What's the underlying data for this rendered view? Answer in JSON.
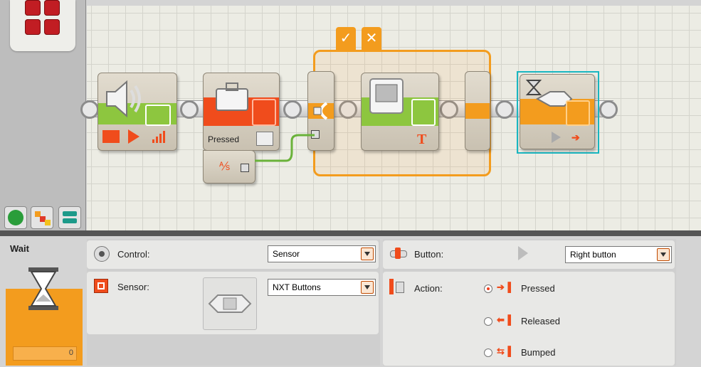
{
  "program": {
    "sound_block": {},
    "nxt_button_block": {
      "label": "Pressed"
    },
    "switch_block": {},
    "wait_block": {}
  },
  "config": {
    "block_title": "Wait",
    "counter_value": "0",
    "control": {
      "label": "Control:",
      "value": "Sensor"
    },
    "sensor": {
      "label": "Sensor:",
      "value": "NXT Buttons"
    },
    "button": {
      "label": "Button:",
      "value": "Right button"
    },
    "action": {
      "label": "Action:",
      "options": [
        "Pressed",
        "Released",
        "Bumped"
      ],
      "selected": "Pressed"
    }
  },
  "colors": {
    "orange": "#f39c1e",
    "red_orange": "#f04c1c",
    "green": "#8dc63f",
    "cyan_selection": "#19b6c0",
    "wire_green": "#6ab23a"
  },
  "icons": [
    "speaker-icon",
    "play-icon",
    "volume-icon",
    "briefcase-icon",
    "display-icon",
    "hourglass-icon",
    "nxt-brick-icon",
    "eye-icon",
    "check-icon",
    "x-icon"
  ]
}
